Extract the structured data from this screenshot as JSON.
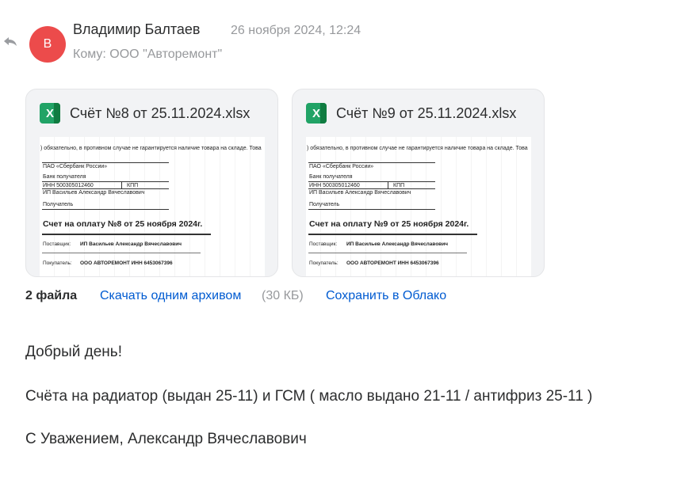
{
  "message": {
    "avatar_letter": "В",
    "sender": "Владимир Балтаев",
    "date": "26 ноября 2024, 12:24",
    "to": "Кому: ООО \"Авторемонт\""
  },
  "attachments": [
    {
      "filename": "Счёт №8 от 25.11.2024.xlsx",
      "icon": "excel-icon",
      "icon_letter": "X",
      "preview": {
        "notice": ") обязательно, в противном случае не гарантируется наличие товара на складе. Това",
        "bank": "ПАО «Сбербанк России»",
        "recipient_bank": "Банк получателя",
        "inn": "ИНН    500305012460",
        "kpp": "КПП",
        "person": "ИП Васильев Александр Вячеславович",
        "getter": "Получатель",
        "title": "Счет на оплату №8 от 25 ноября 2024г.",
        "supplier_label": "Поставщик:",
        "supplier_value": "ИП Васильев Александр Вячеславович",
        "buyer_label": "Покупатель:",
        "buyer_value": "ООО АВТОРЕМОНТ ИНН  6453067396"
      }
    },
    {
      "filename": "Счёт №9 от 25.11.2024.xlsx",
      "icon": "excel-icon",
      "icon_letter": "X",
      "preview": {
        "notice": ") обязательно, в противном случае не гарантируется наличие товара на складе. Това",
        "bank": "ПАО «Сбербанк России»",
        "recipient_bank": "Банк получателя",
        "inn": "ИНН    500305012460",
        "kpp": "КПП",
        "person": "ИП Васильев Александр Вячеславович",
        "getter": "Получатель",
        "title": "Счет на оплату №9 от 25 ноября 2024г.",
        "supplier_label": "Поставщик:",
        "supplier_value": "ИП Васильев Александр Вячеславович",
        "buyer_label": "Покупатель:",
        "buyer_value": "ООО АВТОРЕМОНТ ИНН  6453067396"
      }
    }
  ],
  "files_bar": {
    "count": "2 файла",
    "download_archive": "Скачать одним архивом",
    "size": "(30 КБ)",
    "save_to_cloud": "Сохранить в Облако"
  },
  "body": {
    "greeting": "Добрый день!",
    "text": "Счёта на радиатор (выдан 25-11) и ГСМ ( масло выдано 21-11 / антифриз 25-11 )",
    "signature": "С Уважением, Александр Вячеславович"
  },
  "colors": {
    "avatar": "#ec4b4b",
    "link": "#005bd1",
    "excel": "#21a366"
  }
}
